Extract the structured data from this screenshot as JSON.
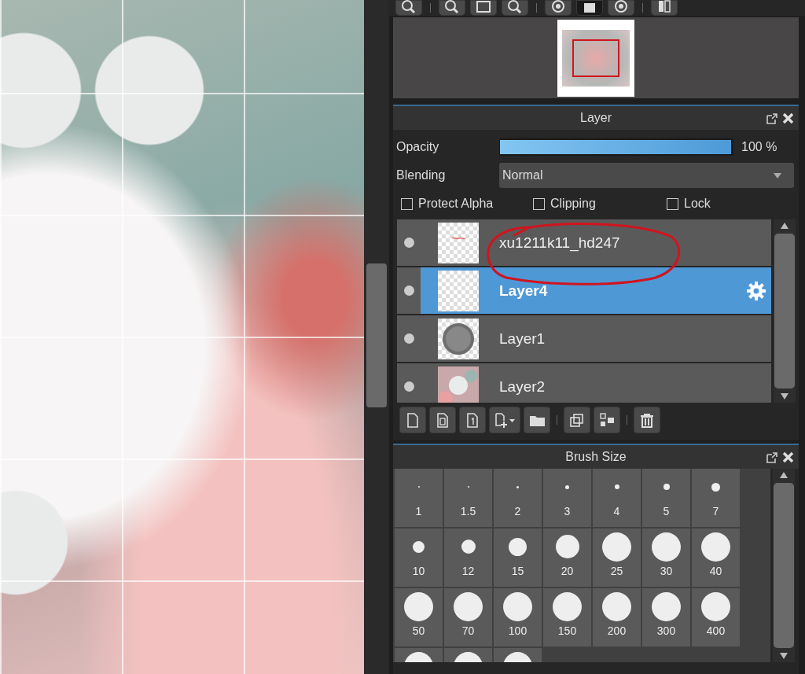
{
  "layer_panel": {
    "title": "Layer",
    "opacity": {
      "label": "Opacity",
      "level": 1,
      "reading": "100 %"
    },
    "blending": {
      "label": "Blending",
      "value": "Normal"
    },
    "options": [
      {
        "label": "Protect Alpha",
        "checked": false
      },
      {
        "label": "Clipping",
        "checked": false
      },
      {
        "label": "Lock",
        "checked": false
      }
    ],
    "layers": [
      {
        "name": "xu1211k11_hd247",
        "kind": "sketch",
        "visible": true,
        "selected": false
      },
      {
        "name": "Layer4",
        "kind": "empty",
        "visible": true,
        "selected": true
      },
      {
        "name": "Layer1",
        "kind": "circle",
        "visible": true,
        "selected": false
      },
      {
        "name": "Layer2",
        "kind": "photo",
        "visible": true,
        "selected": false
      }
    ]
  },
  "brush_size": {
    "title": "Brush Size",
    "sizes": [
      "1",
      "1.5",
      "2",
      "3",
      "4",
      "5",
      "7",
      "10",
      "12",
      "15",
      "20",
      "25",
      "30",
      "40",
      "50",
      "70",
      "100",
      "150",
      "200",
      "300",
      "400"
    ]
  }
}
